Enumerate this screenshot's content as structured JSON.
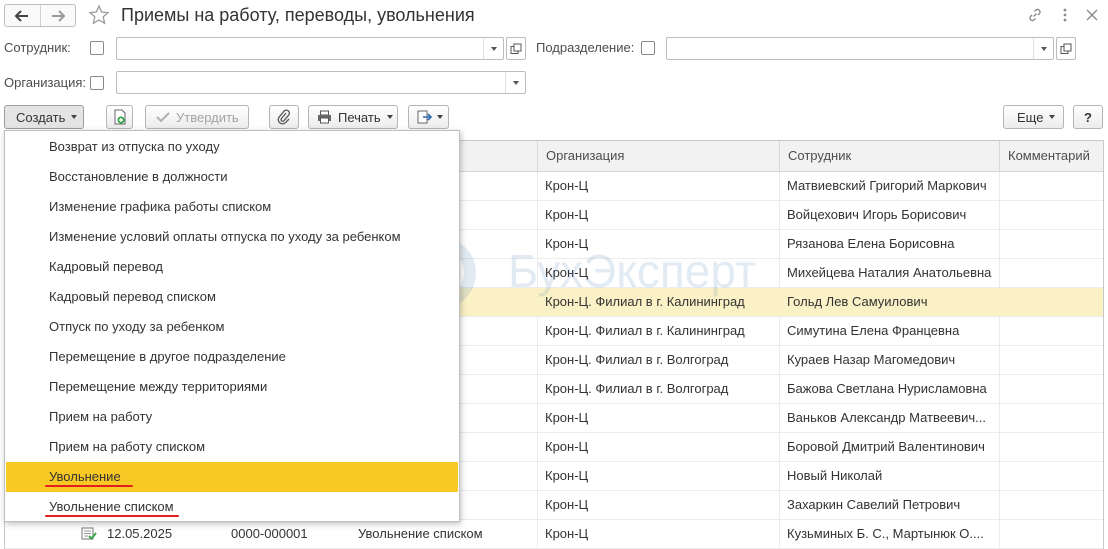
{
  "window": {
    "title": "Приемы на работу, переводы, увольнения"
  },
  "filters": {
    "employee_label": "Сотрудник:",
    "department_label": "Подразделение:",
    "organization_label": "Организация:"
  },
  "toolbar": {
    "create_label": "Создать",
    "approve_label": "Утвердить",
    "print_label": "Печать",
    "more_label": "Еще",
    "help_label": "?"
  },
  "table": {
    "columns": [
      "Организация",
      "Сотрудник",
      "Комментарий"
    ],
    "rows": [
      {
        "org": "Крон-Ц",
        "employee": "Матвиевский Григорий Маркович"
      },
      {
        "org": "Крон-Ц",
        "employee": "Войцехович Игорь Борисович"
      },
      {
        "org": "Крон-Ц",
        "employee": "Рязанова Елена Борисовна"
      },
      {
        "org": "Крон-Ц",
        "employee": "Михейцева Наталия Анатольевна"
      },
      {
        "org": "Крон-Ц. Филиал в г. Калининград",
        "employee": "Гольд Лев Самуилович"
      },
      {
        "org": "Крон-Ц. Филиал в г. Калининград",
        "employee": "Симутина Елена Францевна"
      },
      {
        "org": "Крон-Ц. Филиал в г. Волгоград",
        "employee": "Кураев Назар Магомедович"
      },
      {
        "org": "Крон-Ц. Филиал в г. Волгоград",
        "employee": "Бажова Светлана Нурисламовна"
      },
      {
        "org": "Крон-Ц",
        "employee": "Ваньков Александр Матвеевич..."
      },
      {
        "org": "Крон-Ц",
        "employee": "Боровой Дмитрий Валентинович"
      },
      {
        "org": "Крон-Ц",
        "employee": "Новый Николай"
      },
      {
        "org": "Крон-Ц",
        "employee": "Захаркин Савелий Петрович"
      }
    ],
    "last_row": {
      "date": "12.05.2025",
      "number": "0000-000001",
      "doc_type": "Увольнение списком",
      "org": "Крон-Ц",
      "employee": "Кузьминых Б. С., Мартынюк О...."
    }
  },
  "create_menu": {
    "items": [
      "Возврат из отпуска по уходу",
      "Восстановление в должности",
      "Изменение графика работы списком",
      "Изменение условий оплаты отпуска по уходу за ребенком",
      "Кадровый перевод",
      "Кадровый перевод списком",
      "Отпуск по уходу за ребенком",
      "Перемещение в другое подразделение",
      "Перемещение между территориями",
      "Прием на работу",
      "Прием на работу списком",
      "Увольнение",
      "Увольнение списком"
    ],
    "selected_index": 11
  },
  "watermark": {
    "text": "БухЭксперт"
  },
  "colors": {
    "menu_highlight": "#f8c825",
    "row_highlight": "#fbf1c6",
    "underline": "#e02020"
  }
}
